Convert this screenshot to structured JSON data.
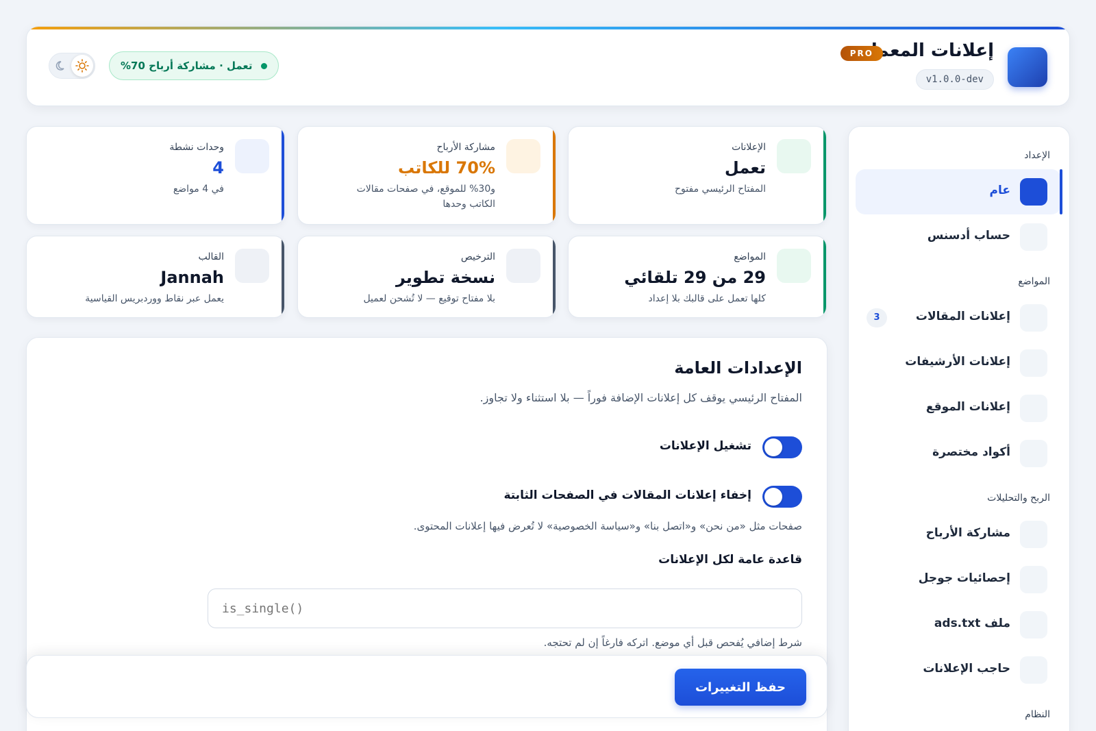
{
  "header": {
    "title": "إعلانات المعمار",
    "badge": "PRO",
    "version": "v1.0.0-dev",
    "status": "تعمل · مشاركة أرباح 70%",
    "theme_icons": [
      "moon-icon",
      "sun-icon"
    ]
  },
  "sidebar": {
    "groups": {
      "setup": "الإعداد",
      "placements": "المواضع",
      "revenue": "الربح والتحليلات",
      "system": "النظام"
    },
    "items": [
      {
        "label": "عام",
        "active": true
      },
      {
        "label": "حساب أدسنس"
      },
      {
        "label": "إعلانات المقالات",
        "count": "3"
      },
      {
        "label": "إعلانات الأرشيفات"
      },
      {
        "label": "إعلانات الموقع"
      },
      {
        "label": "أكواد مختصرة"
      },
      {
        "label": "مشاركة الأرباح"
      },
      {
        "label": "إحصائيات جوجل"
      },
      {
        "label": "ملف ads.txt"
      },
      {
        "label": "حاجب الإعلانات"
      }
    ]
  },
  "stats": [
    {
      "label": "الإعلانات",
      "value": "تعمل",
      "sub": "المفتاح الرئيسي مفتوح",
      "accent": "#059669"
    },
    {
      "label": "مشاركة الأرباح",
      "value": "70% للكاتب",
      "sub": "و30% للموقع، في صفحات مقالات الكاتب وحدها",
      "accent": "#d97706"
    },
    {
      "label": "وحدات نشطة",
      "value": "4",
      "sub": "في 4 مواضع",
      "accent": "#1d4ed8"
    },
    {
      "label": "المواضع",
      "value": "29 من 29 تلقائي",
      "sub": "كلها تعمل على قالبك بلا إعداد",
      "accent": "#059669"
    },
    {
      "label": "الترخيص",
      "value": "نسخة تطوير",
      "sub": "بلا مفتاح توقيع — لا تُشحن لعميل",
      "accent": "#475569"
    },
    {
      "label": "القالب",
      "value": "Jannah",
      "sub": "يعمل عبر نقاط ووردبريس القياسية",
      "accent": "#475569"
    }
  ],
  "main": {
    "title": "الإعدادات العامة",
    "description": "المفتاح الرئيسي يوقف كل إعلانات الإضافة فوراً — بلا استثناء ولا تجاوز.",
    "toggles": [
      {
        "label": "تشغيل الإعلانات",
        "on": true
      },
      {
        "label": "إخفاء إعلانات المقالات في الصفحات الثابتة",
        "on": true
      }
    ],
    "toggle_hint": "صفحات مثل «من نحن» و«اتصل بنا» و«سياسة الخصوصية» لا تُعرض فيها إعلانات المحتوى.",
    "rule_label": "قاعدة عامة لكل الإعلانات",
    "rule_placeholder": "is_single()",
    "rule_hint": "شرط إضافي يُفحص قبل أي موضع. اتركه فارغاً إن لم تحتجه."
  },
  "footer": {
    "save_label": "حفظ التغييرات"
  },
  "colors": {
    "primary": "#1d4ed8",
    "success": "#059669",
    "warning": "#d97706"
  }
}
